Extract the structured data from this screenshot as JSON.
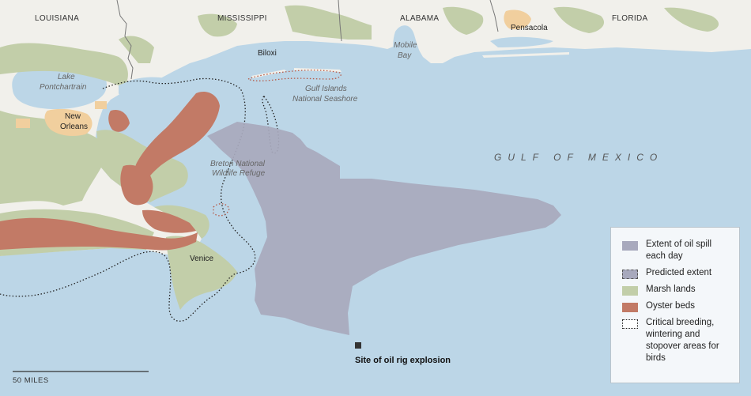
{
  "map": {
    "states": [
      "LOUISIANA",
      "MISSISSIPPI",
      "ALABAMA",
      "FLORIDA"
    ],
    "cities": [
      "Biloxi",
      "Pensacola",
      "Venice"
    ],
    "new_orleans": [
      "New",
      "Orleans"
    ],
    "lake_pontchartrain": [
      "Lake",
      "Pontchartrain"
    ],
    "mobile_bay": [
      "Mobile",
      "Bay"
    ],
    "gulf_islands": [
      "Gulf Islands",
      "National Seashore"
    ],
    "breton": [
      "Breton National",
      "Wildlife Refuge"
    ],
    "gulf_label": "GULF OF MEXICO",
    "site_label": "Site of oil rig explosion",
    "scale_label": "50 MILES"
  },
  "legend": {
    "items": [
      {
        "label": "Extent of oil spill each day",
        "color": "#a8a9bd",
        "style": "solid"
      },
      {
        "label": "Predicted extent",
        "color": "#a8a9bd",
        "style": "dashed"
      },
      {
        "label": "Marsh lands",
        "color": "#c2cea9",
        "style": "solid"
      },
      {
        "label": "Oyster beds",
        "color": "#c27a66",
        "style": "solid"
      },
      {
        "label": "Critical breeding, wintering and stopover areas for birds",
        "color": "#ffffff",
        "style": "dotted"
      }
    ]
  },
  "colors": {
    "water": "#bcd6e7",
    "land": "#f1f0eb",
    "marsh": "#c2cea9",
    "oyster": "#c27a66",
    "spill": "#a8a9bd",
    "urban": "#f1cf9e"
  }
}
